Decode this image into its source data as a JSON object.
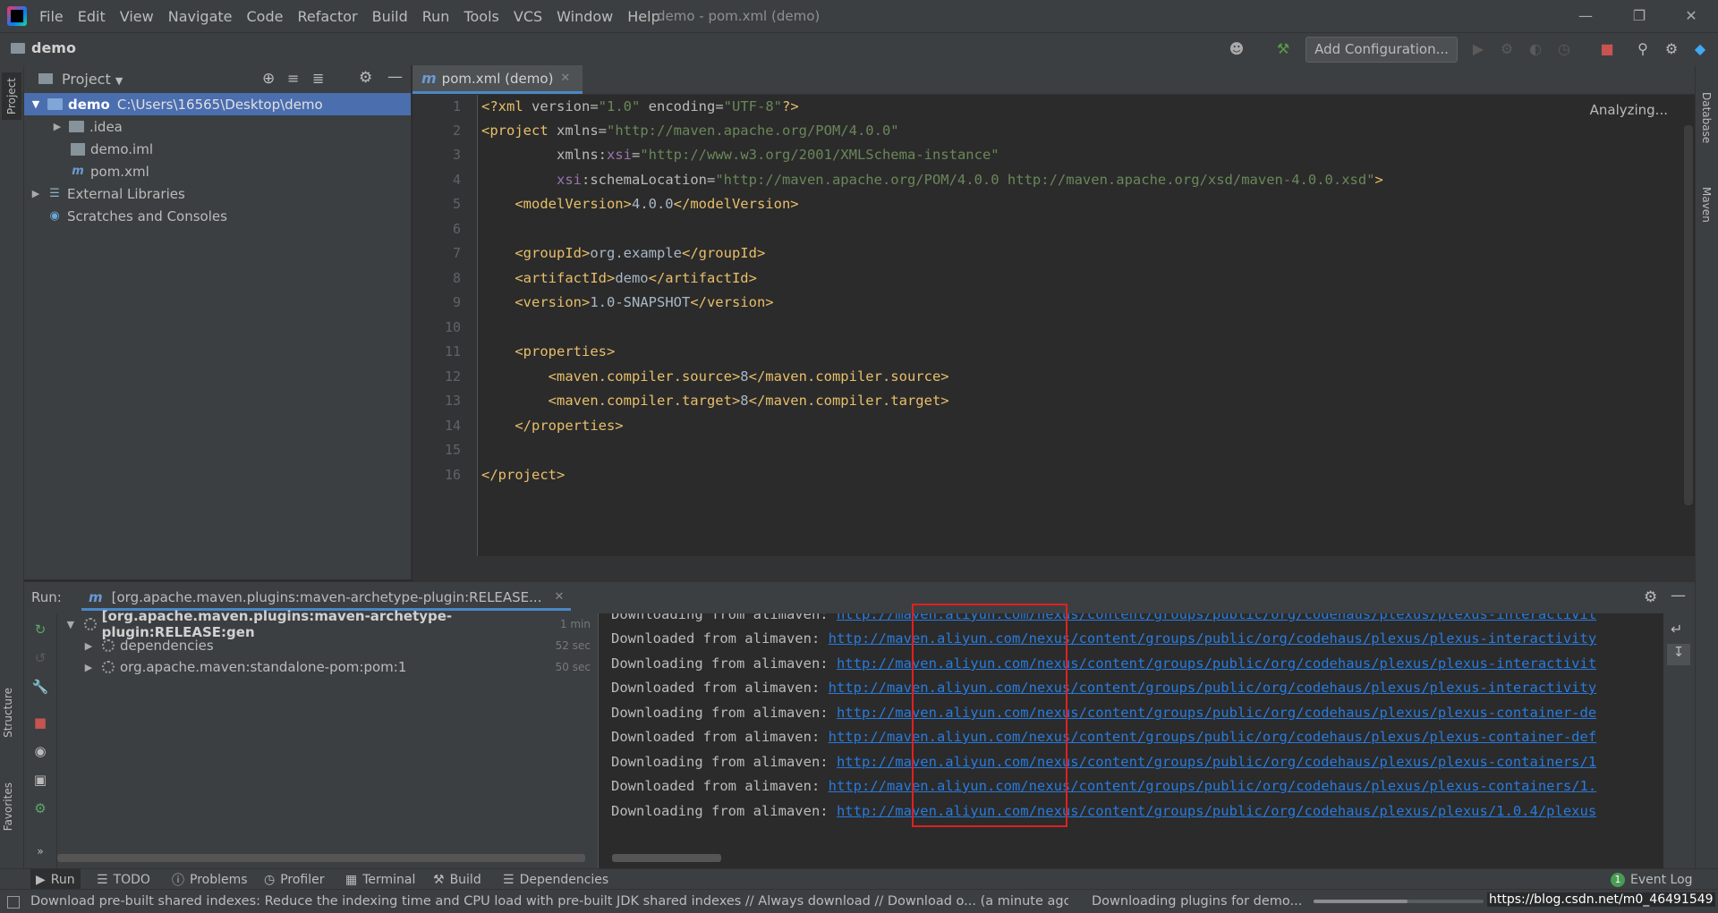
{
  "menubar": {
    "items": [
      "File",
      "Edit",
      "View",
      "Navigate",
      "Code",
      "Refactor",
      "Build",
      "Run",
      "Tools",
      "VCS",
      "Window",
      "Help"
    ],
    "window_title": "demo - pom.xml (demo)"
  },
  "navbar": {
    "project_name": "demo",
    "add_config_label": "Add Configuration..."
  },
  "left_stripe": {
    "project_tab": "Project",
    "structure_tab": "Structure",
    "favorites_tab": "Favorites"
  },
  "right_stripe": {
    "database_tab": "Database",
    "maven_tab": "Maven"
  },
  "project_panel": {
    "title": "Project",
    "tree": [
      {
        "name": "demo",
        "path": "C:\\Users\\16565\\Desktop\\demo"
      },
      {
        "name": ".idea"
      },
      {
        "name": "demo.iml"
      },
      {
        "name": "pom.xml"
      },
      {
        "name": "External Libraries"
      },
      {
        "name": "Scratches and Consoles"
      }
    ]
  },
  "editor": {
    "tab_label": "pom.xml (demo)",
    "status": "Analyzing...",
    "line_numbers": [
      "1",
      "2",
      "3",
      "4",
      "5",
      "6",
      "7",
      "8",
      "9",
      "10",
      "11",
      "12",
      "13",
      "14",
      "15",
      "16"
    ]
  },
  "run_panel": {
    "label": "Run:",
    "tab_label": "[org.apache.maven.plugins:maven-archetype-plugin:RELEASE...",
    "tree": [
      {
        "label": "[org.apache.maven.plugins:maven-archetype-plugin:RELEASE:gen",
        "time": "1 min"
      },
      {
        "label": "dependencies",
        "time": "52 sec"
      },
      {
        "label": "org.apache.maven:standalone-pom:pom:1",
        "time": "50 sec"
      }
    ],
    "console": [
      {
        "prefix": "Downloading from alimaven: ",
        "url": "http://maven.aliyun.com/nexus/content/groups/public/org/codehaus/plexus/plexus-interactivit"
      },
      {
        "prefix": "Downloaded from alimaven: ",
        "url": "http://maven.aliyun.com/nexus/content/groups/public/org/codehaus/plexus/plexus-interactivity"
      },
      {
        "prefix": "Downloading from alimaven: ",
        "url": "http://maven.aliyun.com/nexus/content/groups/public/org/codehaus/plexus/plexus-interactivit"
      },
      {
        "prefix": "Downloaded from alimaven: ",
        "url": "http://maven.aliyun.com/nexus/content/groups/public/org/codehaus/plexus/plexus-interactivity"
      },
      {
        "prefix": "Downloading from alimaven: ",
        "url": "http://maven.aliyun.com/nexus/content/groups/public/org/codehaus/plexus/plexus-container-de"
      },
      {
        "prefix": "Downloaded from alimaven: ",
        "url": "http://maven.aliyun.com/nexus/content/groups/public/org/codehaus/plexus/plexus-container-def"
      },
      {
        "prefix": "Downloading from alimaven: ",
        "url": "http://maven.aliyun.com/nexus/content/groups/public/org/codehaus/plexus/plexus-containers/1"
      },
      {
        "prefix": "Downloaded from alimaven: ",
        "url": "http://maven.aliyun.com/nexus/content/groups/public/org/codehaus/plexus/plexus-containers/1."
      },
      {
        "prefix": "Downloading from alimaven: ",
        "url": "http://maven.aliyun.com/nexus/content/groups/public/org/codehaus/plexus/plexus/1.0.4/plexus"
      }
    ]
  },
  "bottom_tabs": {
    "run": "Run",
    "todo": "TODO",
    "problems": "Problems",
    "profiler": "Profiler",
    "terminal": "Terminal",
    "build": "Build",
    "dependencies": "Dependencies",
    "event_log": "Event Log",
    "event_count": "1"
  },
  "statusbar": {
    "message": "Download pre-built shared indexes: Reduce the indexing time and CPU load with pre-built JDK shared indexes // Always download // Download o... (a minute ago)",
    "progress_text": "Downloading plugins for demo...",
    "progress_fraction": 0.55,
    "watermark": "https://blog.csdn.net/m0_46491549"
  },
  "colors": {
    "accent": "#4a88c7",
    "selection": "#4b6eaf",
    "link": "#287bde",
    "highlight_box": "#e02020"
  }
}
